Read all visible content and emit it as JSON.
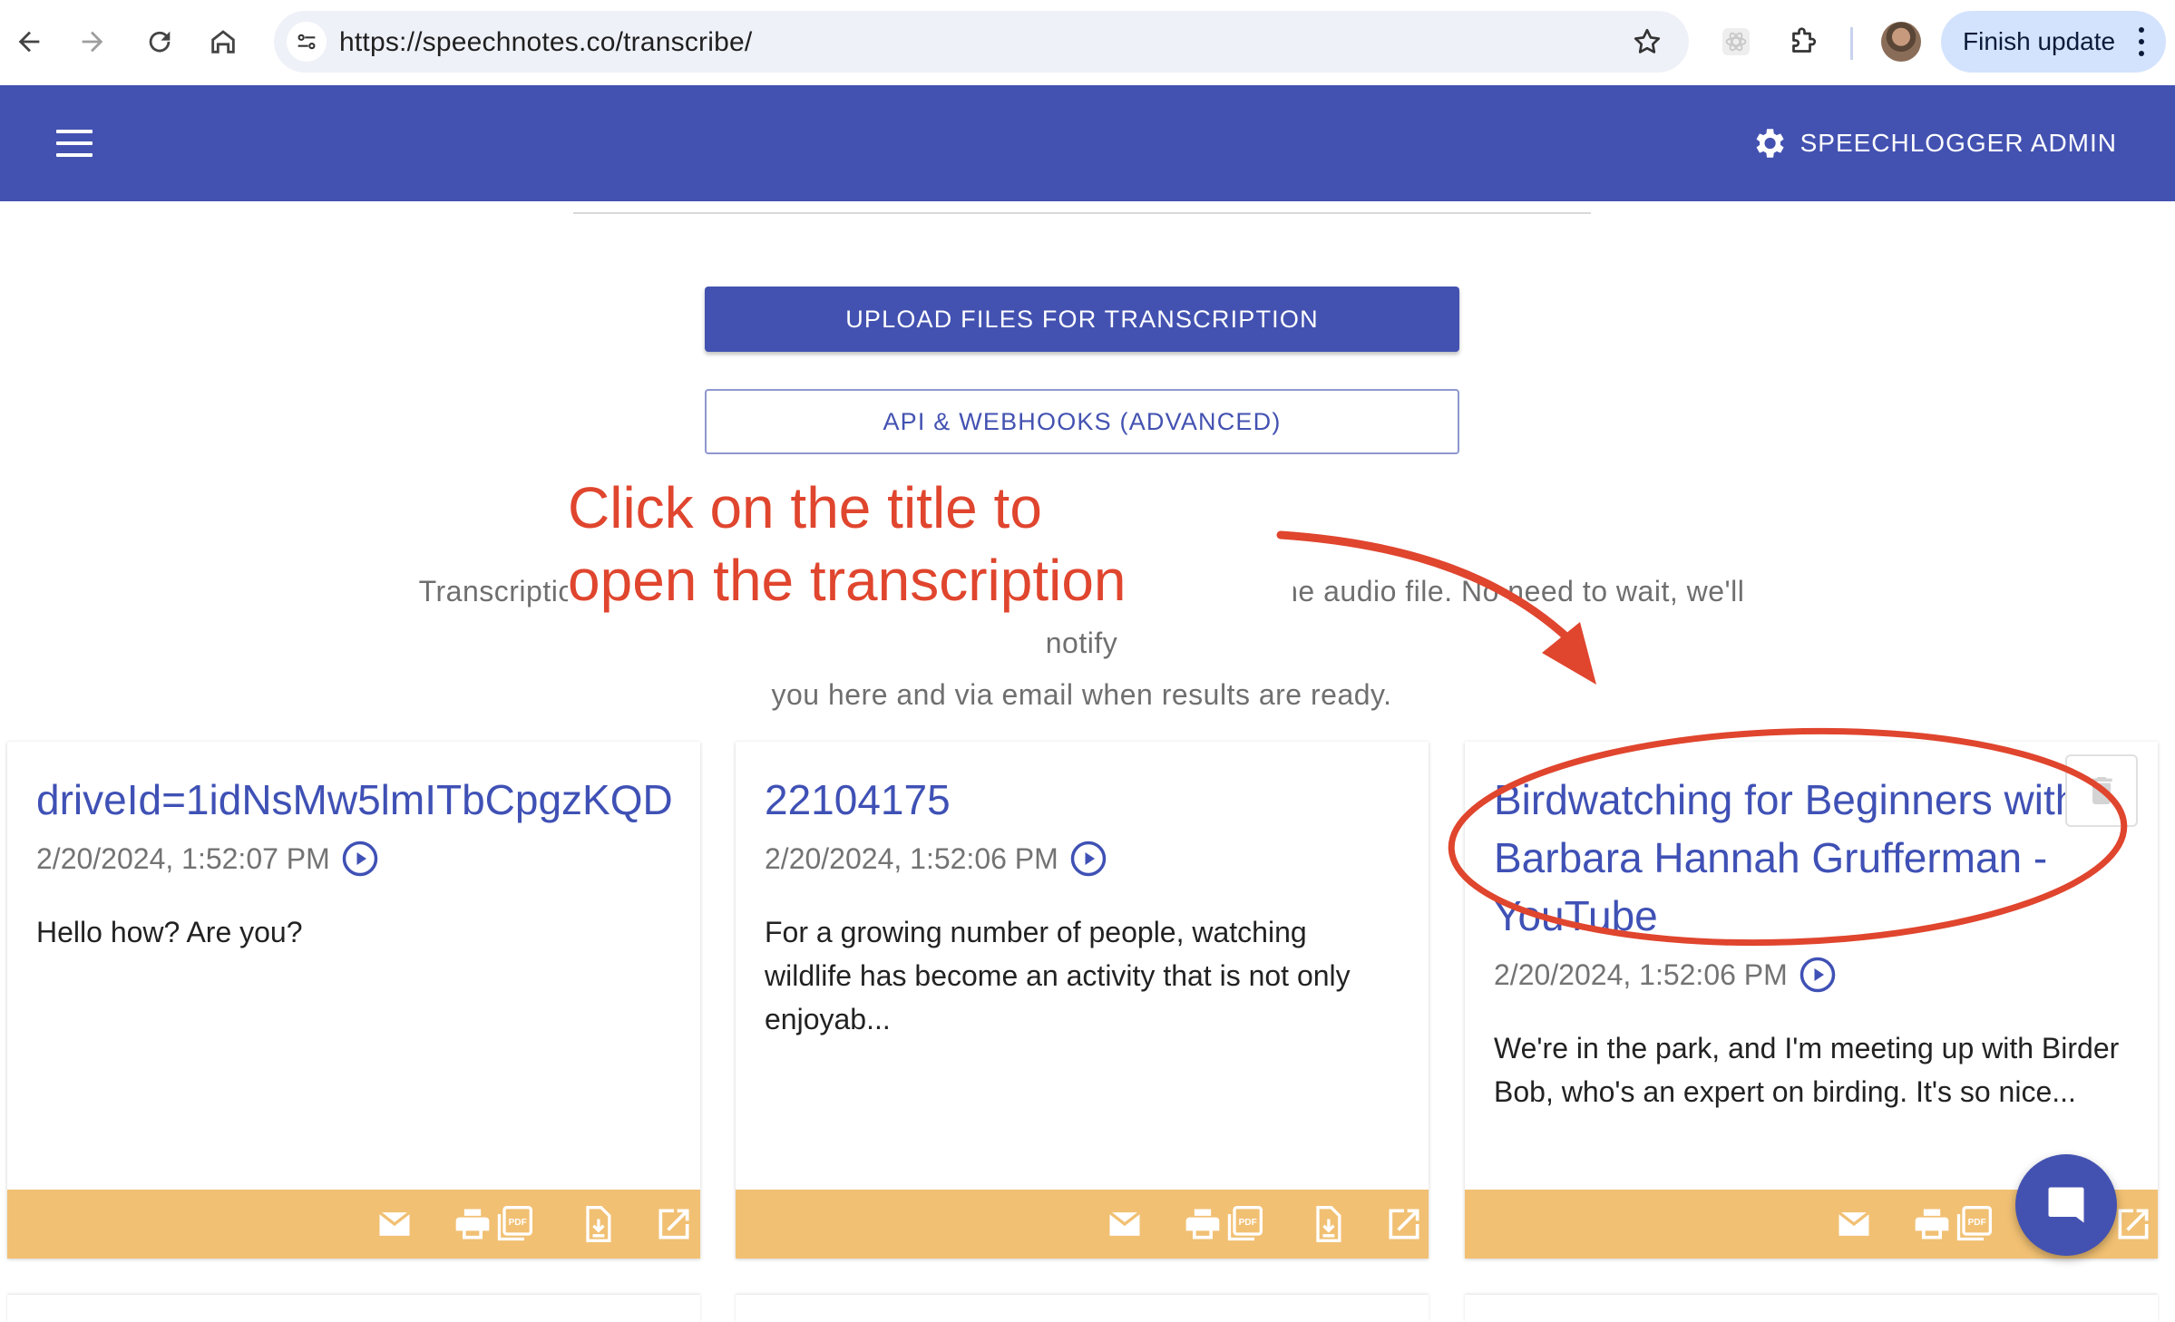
{
  "browser": {
    "url": "https://speechnotes.co/transcribe/",
    "finish_update_label": "Finish update"
  },
  "app_bar": {
    "admin_label": "SPEECHLOGGER ADMIN"
  },
  "actions": {
    "upload_label": "UPLOAD FILES FOR TRANSCRIPTION",
    "api_label": "API & WEBHOOKS (ADVANCED)"
  },
  "info": {
    "line1": "Transcription will take a few minutes depending on the length of the audio file. No need to wait, we'll notify",
    "line2": "you here and via email when results are ready."
  },
  "annotation": {
    "line1": "Click on the title to",
    "line2": "open the transcription",
    "color": "#e0452e"
  },
  "cards": [
    {
      "title": "driveId=1idNsMw5lmITbCpgzKQD",
      "date": "2/20/2024, 1:52:07 PM",
      "snippet": "Hello how? Are you?"
    },
    {
      "title": "22104175",
      "date": "2/20/2024, 1:52:06 PM",
      "snippet": "For a growing number of people, watching wildlife has become an activity that is not only enjoyab..."
    },
    {
      "title": "Birdwatching for Beginners with Barbara Hannah Grufferman - YouTube",
      "date": "2/20/2024, 1:52:06 PM",
      "snippet": "We're in the park, and I'm meeting up with Birder Bob, who's an expert on birding. It's so nice..."
    }
  ],
  "colors": {
    "brand": "#4352b1",
    "footer": "#f1c073",
    "title_link": "#3f51b5"
  },
  "icons": [
    "back-icon",
    "forward-icon",
    "reload-icon",
    "home-icon",
    "site-info-icon",
    "star-icon",
    "extension-icon",
    "puzzle-icon",
    "menu-icon",
    "gear-icon",
    "play-circle-icon",
    "email-icon",
    "print-icon",
    "pdf-icon",
    "download-icon",
    "open-external-icon",
    "delete-icon",
    "chat-icon"
  ]
}
